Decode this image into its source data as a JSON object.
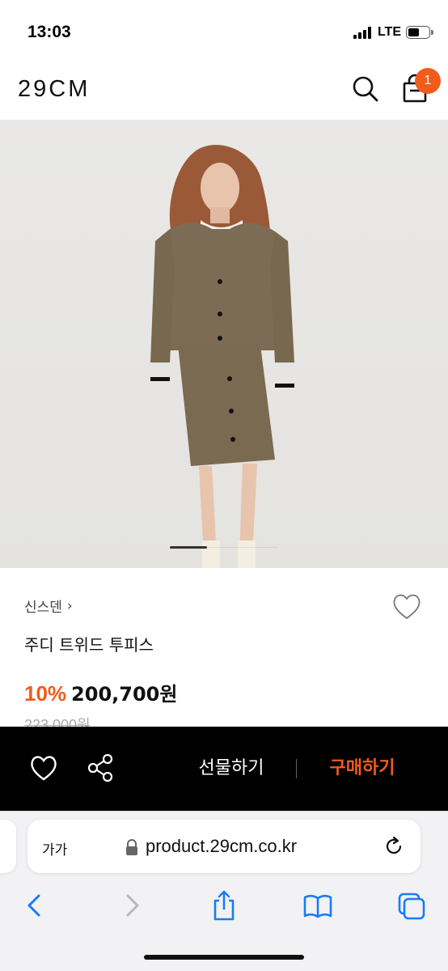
{
  "status_bar": {
    "time": "13:03",
    "network": "LTE"
  },
  "header": {
    "logo": "29CM",
    "cart_count": "1"
  },
  "product": {
    "brand": "신스덴",
    "brand_chevron": "›",
    "name": "주디 트위드 투피스",
    "discount": "10%",
    "price": "200,700원",
    "original_price": "223,000원"
  },
  "action_bar": {
    "gift_label": "선물하기",
    "buy_label": "구매하기"
  },
  "browser": {
    "text_size_label": "가가",
    "url": "product.29cm.co.kr"
  },
  "colors": {
    "accent": "#f25b1b",
    "action_bar_bg": "#000000",
    "safari_blue": "#1a7cf5"
  },
  "icons": [
    "search-icon",
    "cart-icon",
    "heart-icon",
    "share-icon",
    "lock-icon",
    "reload-icon",
    "back-icon",
    "forward-icon",
    "bookmarks-icon",
    "tabs-icon"
  ]
}
